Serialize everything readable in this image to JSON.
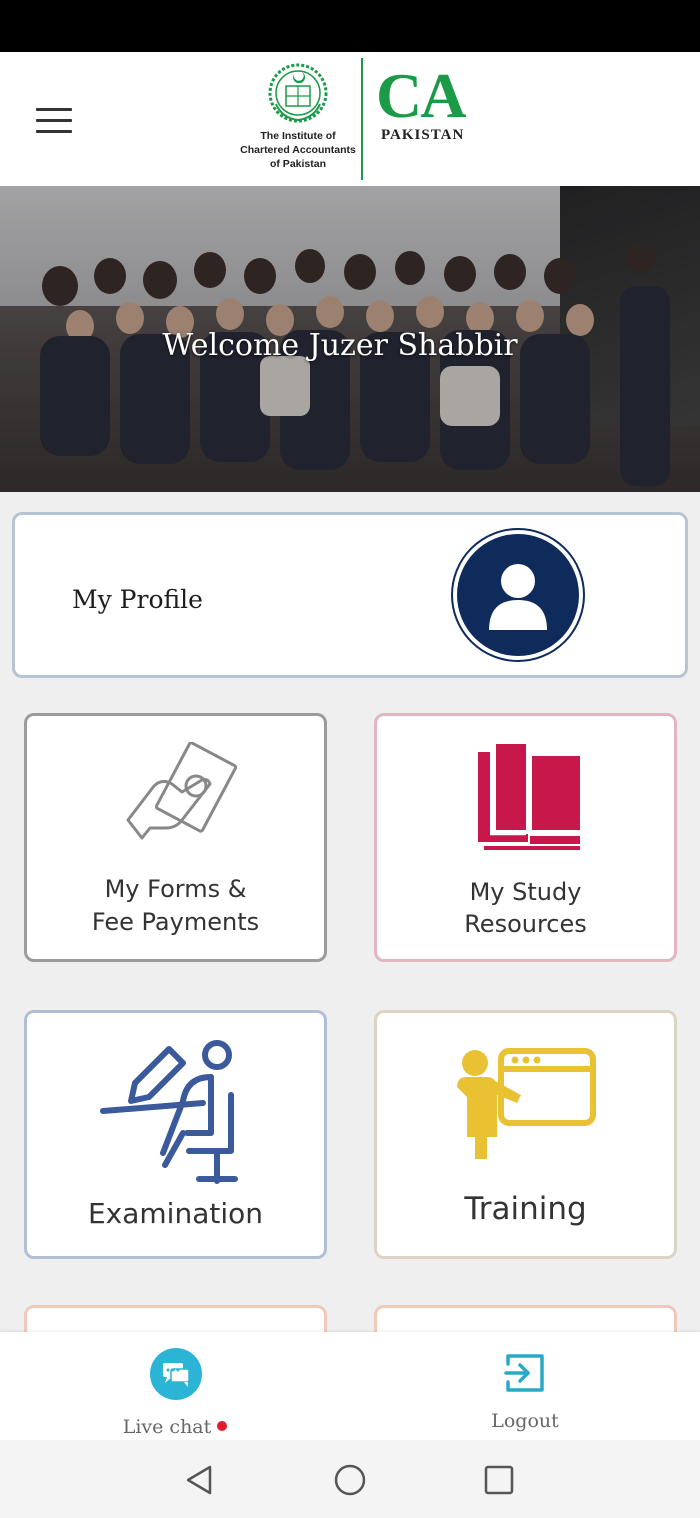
{
  "header": {
    "menu_icon": "hamburger-menu-icon",
    "logo": {
      "institute_lines": [
        "The Institute of",
        "Chartered Accountants",
        "of Pakistan"
      ],
      "ca": "CA",
      "country": "PAKISTAN",
      "brand_color": "#1b9a48"
    }
  },
  "hero": {
    "welcome": "Welcome Juzer Shabbir"
  },
  "profile": {
    "label": "My Profile",
    "icon": "user-avatar-icon",
    "avatar_color": "#0e2b5c"
  },
  "tiles": [
    {
      "id": "forms",
      "lines": [
        "My Forms &",
        "Fee Payments"
      ],
      "icon": "hand-money-icon",
      "border": "#9b9b9b"
    },
    {
      "id": "study",
      "lines": [
        "My Study",
        "Resources"
      ],
      "icon": "open-book-icon",
      "border": "#e3b5c0",
      "icon_color": "#c8174b"
    },
    {
      "id": "exam",
      "lines": [
        "Examination"
      ],
      "icon": "exam-writing-icon",
      "border": "#b0bfd4",
      "icon_color": "#3a5a9c"
    },
    {
      "id": "training",
      "lines": [
        "Training"
      ],
      "icon": "presentation-icon",
      "border": "#ddd3c5",
      "icon_color": "#e8c232"
    }
  ],
  "bottom_nav": {
    "chat_label": "Live chat",
    "chat_icon": "chat-bubble-icon",
    "chat_color": "#2bb4d6",
    "logout_label": "Logout",
    "logout_icon": "logout-icon"
  },
  "system_nav": [
    "back-icon",
    "home-icon",
    "recents-icon"
  ]
}
